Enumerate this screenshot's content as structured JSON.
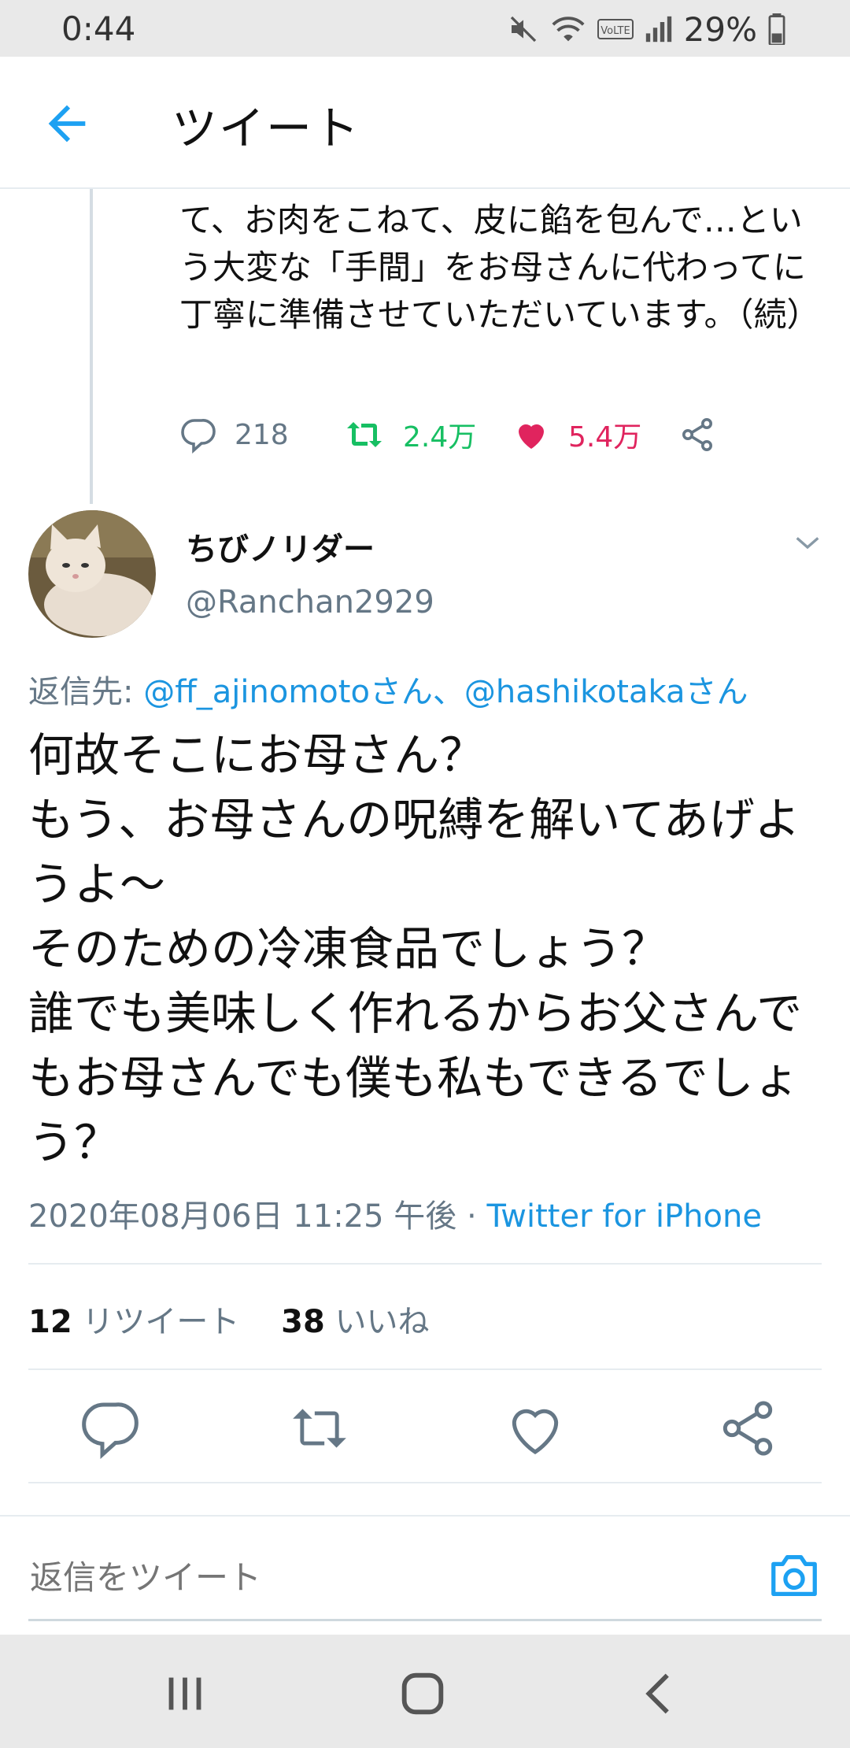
{
  "status_bar": {
    "time": "0:44",
    "battery": "29%"
  },
  "header": {
    "title": "ツイート"
  },
  "prev_tweet": {
    "text": "て、お肉をこねて、皮に餡を包んで…という大変な「手間」をお母さんに代わってに丁寧に準備させていただいています。（続）",
    "replies": "218",
    "retweets": "2.4万",
    "likes": "5.4万"
  },
  "tweet": {
    "author_name": "ちびノリダー",
    "author_handle": "@Ranchan2929",
    "replying_label": "返信先: ",
    "mention1": "@ff_ajinomotoさん",
    "separator": "、",
    "mention2": "@hashikotakaさん",
    "body": "何故そこにお母さん？\nもう、お母さんの呪縛を解いてあげようよ〜\nそのための冷凍食品でしょう？\n誰でも美味しく作れるからお父さんでもお母さんでも僕も私もできるでしょう？",
    "timestamp": "2020年08月06日 11:25 午後 · ",
    "source": "Twitter for iPhone",
    "retweet_count": "12",
    "retweet_label": " リツイート",
    "like_count": "38",
    "like_label": " いいね"
  },
  "reply_box": {
    "placeholder": "返信をツイート"
  },
  "colors": {
    "accent": "#1da1f2",
    "retweet": "#17bf63",
    "like": "#e0245e",
    "muted": "#657786"
  },
  "icons": [
    "back-arrow-icon",
    "reply-icon",
    "retweet-icon",
    "heart-icon",
    "share-icon",
    "chevron-down-icon",
    "camera-icon"
  ]
}
